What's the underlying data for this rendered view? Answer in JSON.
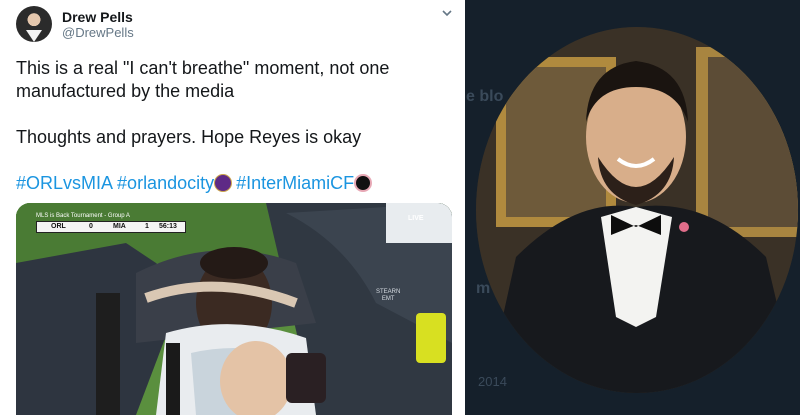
{
  "tweet": {
    "author_name": "Drew Pells",
    "author_handle": "@DrewPells",
    "paragraph1_line1": "This is a real \"I can't breathe\" moment, not one",
    "paragraph1_line2": "manufactured by the media",
    "paragraph2": "Thoughts and prayers. Hope Reyes is okay",
    "hashtags": [
      "#ORLvsMIA",
      "#orlandocity",
      "#InterMiamiCF"
    ],
    "link_color": "#1b95e0",
    "text_color": "#14171a",
    "muted_color": "#657786",
    "caret_icon": "chevron-down-icon"
  },
  "media": {
    "scorebug_title": "MLS is Back Tournament - Group A",
    "home_team": "ORL",
    "home_score": "0",
    "away_team": "MIA",
    "away_score": "1",
    "clock": "56:13",
    "live_label": "LIVE",
    "shirt_text_line1": "STEARN",
    "shirt_text_line2": "EMT"
  },
  "right_panel": {
    "background_color": "#15202b",
    "bg_text_1": "e blo",
    "bg_text_2": "2014",
    "bg_text_3": "m"
  }
}
